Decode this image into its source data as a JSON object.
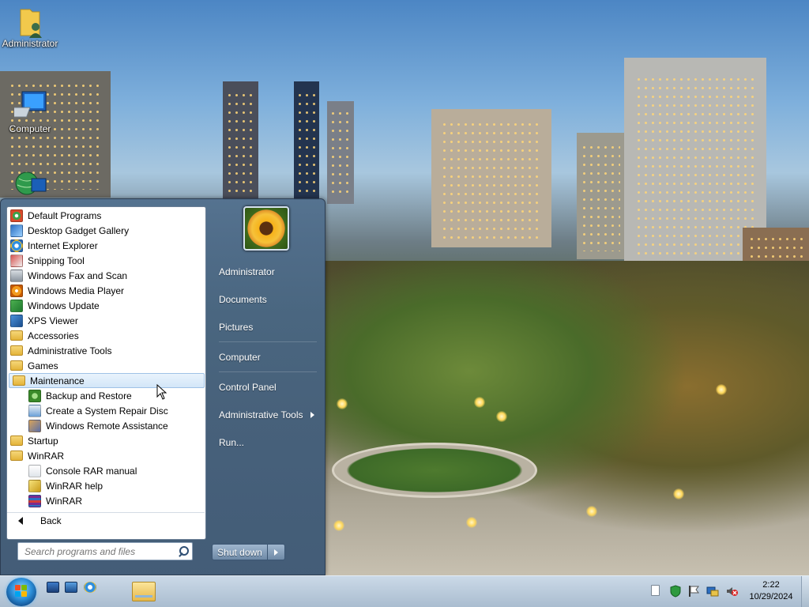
{
  "desktop": {
    "icons": [
      {
        "label": "Administrator",
        "icon": "user-folder-icon"
      },
      {
        "label": "Computer",
        "icon": "computer-icon"
      },
      {
        "label": "",
        "icon": "network-globe-icon"
      }
    ]
  },
  "start_menu": {
    "programs": [
      {
        "label": "Default Programs",
        "icon": "default-programs-icon"
      },
      {
        "label": "Desktop Gadget Gallery",
        "icon": "gadget-gallery-icon"
      },
      {
        "label": "Internet Explorer",
        "icon": "internet-explorer-icon"
      },
      {
        "label": "Snipping Tool",
        "icon": "snipping-tool-icon"
      },
      {
        "label": "Windows Fax and Scan",
        "icon": "fax-scan-icon"
      },
      {
        "label": "Windows Media Player",
        "icon": "media-player-icon"
      },
      {
        "label": "Windows Update",
        "icon": "windows-update-icon"
      },
      {
        "label": "XPS Viewer",
        "icon": "xps-viewer-icon"
      },
      {
        "label": "Accessories",
        "icon": "folder-icon"
      },
      {
        "label": "Administrative Tools",
        "icon": "folder-icon"
      },
      {
        "label": "Games",
        "icon": "folder-icon"
      },
      {
        "label": "Maintenance",
        "icon": "folder-icon",
        "selected": true
      },
      {
        "label": "Backup and Restore",
        "icon": "backup-restore-icon",
        "sub": true
      },
      {
        "label": "Create a System Repair Disc",
        "icon": "repair-disc-icon",
        "sub": true
      },
      {
        "label": "Windows Remote Assistance",
        "icon": "remote-assistance-icon",
        "sub": true
      },
      {
        "label": "Startup",
        "icon": "folder-icon"
      },
      {
        "label": "WinRAR",
        "icon": "folder-icon"
      },
      {
        "label": "Console RAR manual",
        "icon": "document-icon",
        "sub": true
      },
      {
        "label": "WinRAR help",
        "icon": "help-file-icon",
        "sub": true
      },
      {
        "label": "WinRAR",
        "icon": "winrar-icon",
        "sub": true
      }
    ],
    "back_label": "Back",
    "search_placeholder": "Search programs and files",
    "right_items": [
      {
        "label": "Administrator"
      },
      {
        "label": "Documents"
      },
      {
        "label": "Pictures"
      },
      {
        "label": "Computer"
      },
      {
        "label": "Control Panel"
      },
      {
        "label": "Administrative Tools",
        "has_submenu": true
      },
      {
        "label": "Run..."
      }
    ],
    "shutdown_label": "Shut down"
  },
  "taskbar": {
    "time": "2:22",
    "date": "10/29/2024",
    "quick_launch": [
      "show-desktop-icon",
      "switch-windows-icon",
      "internet-explorer-icon"
    ],
    "pinned": [
      "windows-explorer-icon"
    ],
    "tray": [
      "action-center-icon",
      "security-shield-icon",
      "flag-icon",
      "network-icon",
      "volume-muted-icon"
    ]
  }
}
